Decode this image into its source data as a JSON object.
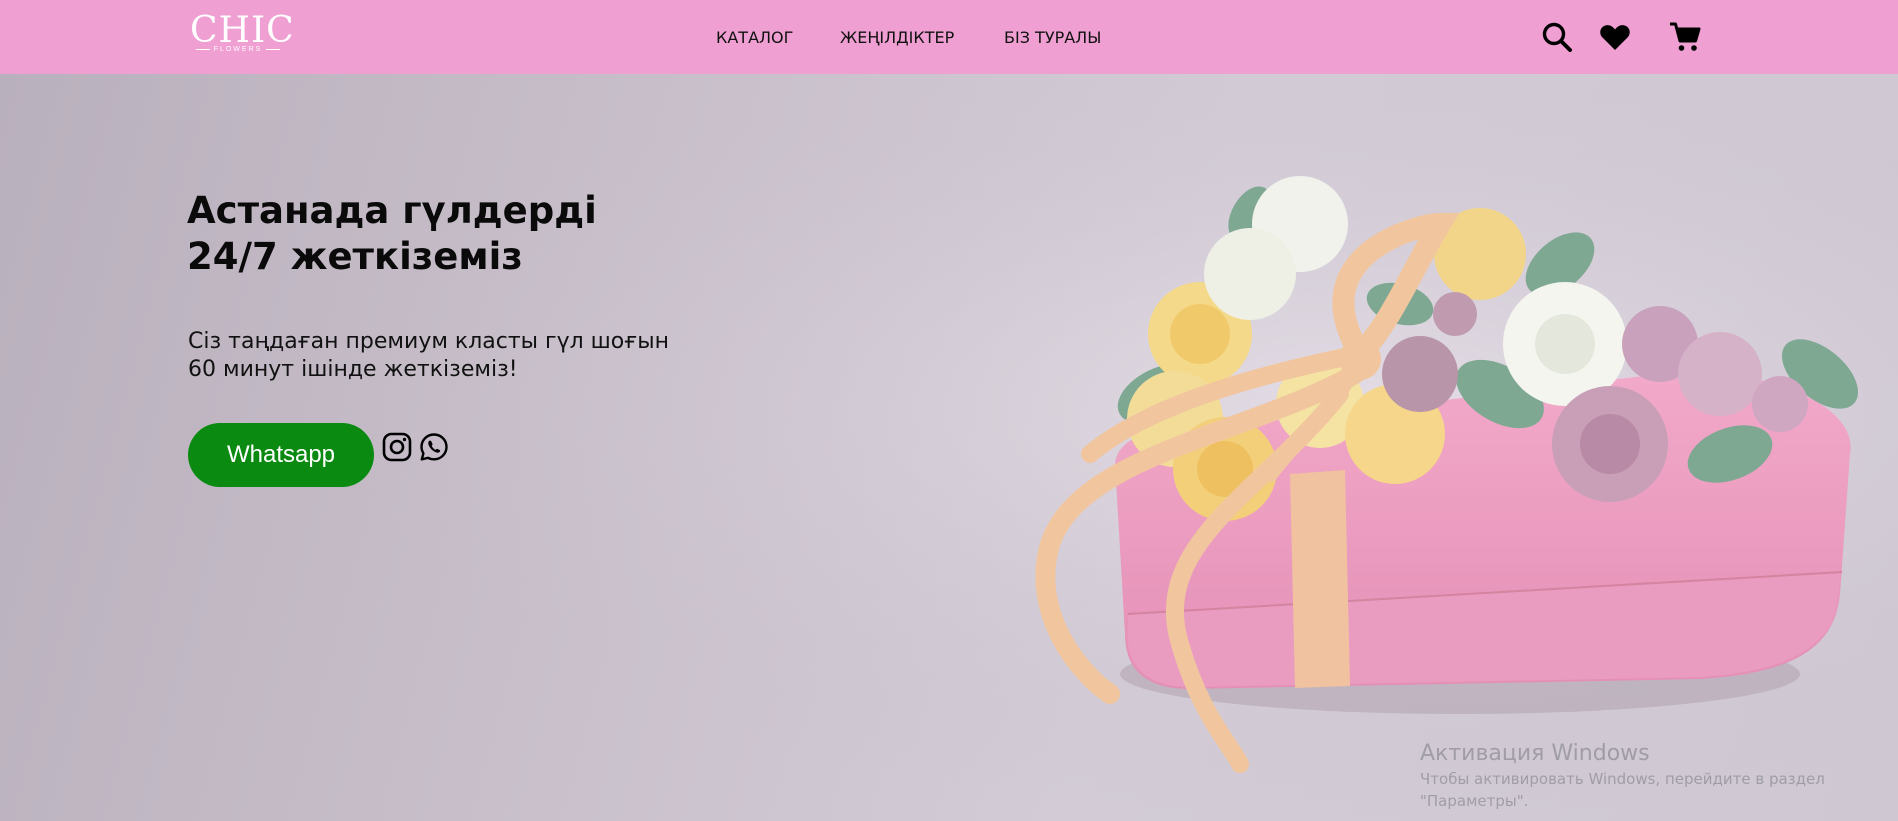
{
  "brand": {
    "logo_text": "CHIC",
    "logo_subtext": "FLOWERS"
  },
  "nav": {
    "items": [
      "КАТАЛОГ",
      "ЖЕҢІЛДІКТЕР",
      "БІЗ ТУРАЛЫ"
    ]
  },
  "header_icons": [
    "search-icon",
    "heart-icon",
    "cart-icon"
  ],
  "hero": {
    "title_line1": "Астанада гүлдерді",
    "title_line2": "24/7 жеткіземіз",
    "subtitle_line1": "Сіз таңдаған премиум класты гүл шоғын",
    "subtitle_line2": "60 минут ішінде жеткіземіз!",
    "cta_label": "Whatsapp",
    "social_icons": [
      "instagram-icon",
      "whatsapp-icon"
    ]
  },
  "watermark": {
    "line1": "Активация Windows",
    "line2": "Чтобы активировать Windows, перейдите в раздел",
    "line3": "\"Параметры\"."
  },
  "colors": {
    "header_bg": "#ef9fd2",
    "cta_bg": "#0a8a10",
    "text": "#0a0a0a"
  }
}
